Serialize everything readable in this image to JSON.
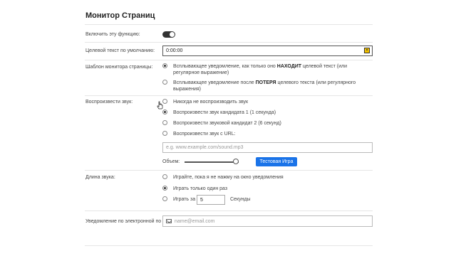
{
  "page": {
    "title": "Монитор Страниц"
  },
  "enable": {
    "label": "Включить эту функцию:",
    "enabled": true
  },
  "target_text": {
    "label": "Целевой текст по умолчанию:",
    "value": "0:00:00",
    "icon": "person-badge-icon"
  },
  "template": {
    "label": "Шаблон монитора страницы:",
    "option1": {
      "prefix": "Всплывающее уведомление, как только оно ",
      "bold": "НАХОДИТ",
      "suffix": " целевой текст (или",
      "line2": "регулярное выражение)",
      "checked": true
    },
    "option2": {
      "prefix": "Всплывающее уведомление после ",
      "bold": "ПОТЕРЯ",
      "suffix": " целевого текста (или регулярного",
      "line2": "выражения)",
      "checked": false
    }
  },
  "sound": {
    "label": "Воспроизвести звук:",
    "options": [
      {
        "label": "Никогда не воспроизводить звук",
        "checked": false
      },
      {
        "label": "Воспроизвести звук кандидата 1 (1 секунда)",
        "checked": true
      },
      {
        "label": "Воспроизвести звуковой кандидат 2 (6 секунд)",
        "checked": false
      },
      {
        "label": "Воспроизвести звук с URL:",
        "checked": false
      }
    ],
    "url_placeholder": "e.g. www.example.com/sound.mp3",
    "volume_label": "Объем:",
    "volume_level": 0.95,
    "test_button": "Тестовая Игра"
  },
  "length": {
    "label": "Длина звука:",
    "option1": {
      "label": "Играйте, пока я не нажму на окно уведомления",
      "checked": false
    },
    "option2": {
      "label": "Играть только один раз",
      "checked": true
    },
    "option3": {
      "prefix": "Играть за",
      "value": "5",
      "suffix": "Секунды",
      "checked": false
    }
  },
  "email": {
    "label": "Уведомление по электронной по",
    "placeholder": "name@email.com",
    "icon": "mail-icon"
  }
}
